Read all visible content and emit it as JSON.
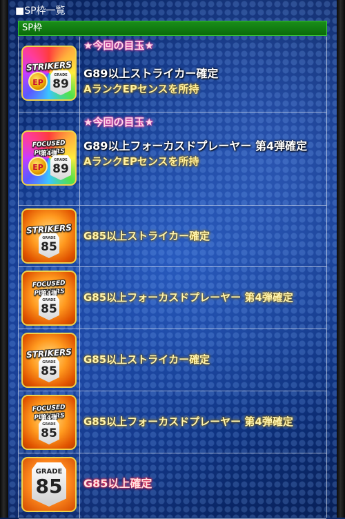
{
  "header": {
    "title": "■SP枠一覧"
  },
  "section": {
    "label": "SP枠"
  },
  "rows": [
    {
      "badge": "★今回の目玉★",
      "title": "G89以上ストライカー確定",
      "subtitle": "AランクEPセンスを所持",
      "icon": {
        "banner": "STRIKERS",
        "grade_label": "GRADE",
        "grade": "89",
        "ep": "EP",
        "style": "special"
      }
    },
    {
      "badge": "★今回の目玉★",
      "title": "G89以上フォーカスドプレーヤー 第4弾確定",
      "subtitle": "AランクEPセンスを所持",
      "icon": {
        "banner": "FOCUSED PLAYERS",
        "banner_sub": "第4弾",
        "grade_label": "GRADE",
        "grade": "89",
        "ep": "EP",
        "style": "special"
      }
    },
    {
      "title": "G85以上ストライカー確定",
      "icon": {
        "banner": "STRIKERS",
        "grade_label": "GRADE",
        "grade": "85",
        "style": "orange"
      }
    },
    {
      "title": "G85以上フォーカスドプレーヤー 第4弾確定",
      "icon": {
        "banner": "FOCUSED PLAYERS",
        "banner_sub": "第4弾",
        "grade_label": "GRADE",
        "grade": "85",
        "style": "orange"
      }
    },
    {
      "title": "G85以上ストライカー確定",
      "icon": {
        "banner": "STRIKERS",
        "grade_label": "GRADE",
        "grade": "85",
        "style": "orange"
      }
    },
    {
      "title": "G85以上フォーカスドプレーヤー 第4弾確定",
      "icon": {
        "banner": "FOCUSED PLAYERS",
        "banner_sub": "第4弾",
        "grade_label": "GRADE",
        "grade": "85",
        "style": "orange"
      }
    },
    {
      "title": "G85以上確定",
      "icon": {
        "grade_label": "GRADE",
        "grade": "85",
        "style": "gray"
      }
    }
  ],
  "colors": {
    "section_bar": "#0a6a0a",
    "badge_glow": "#ff3fa0",
    "yellow_glow": "#d4a000",
    "red_glow": "#ff2040",
    "icon_border": "#f0d24a"
  }
}
